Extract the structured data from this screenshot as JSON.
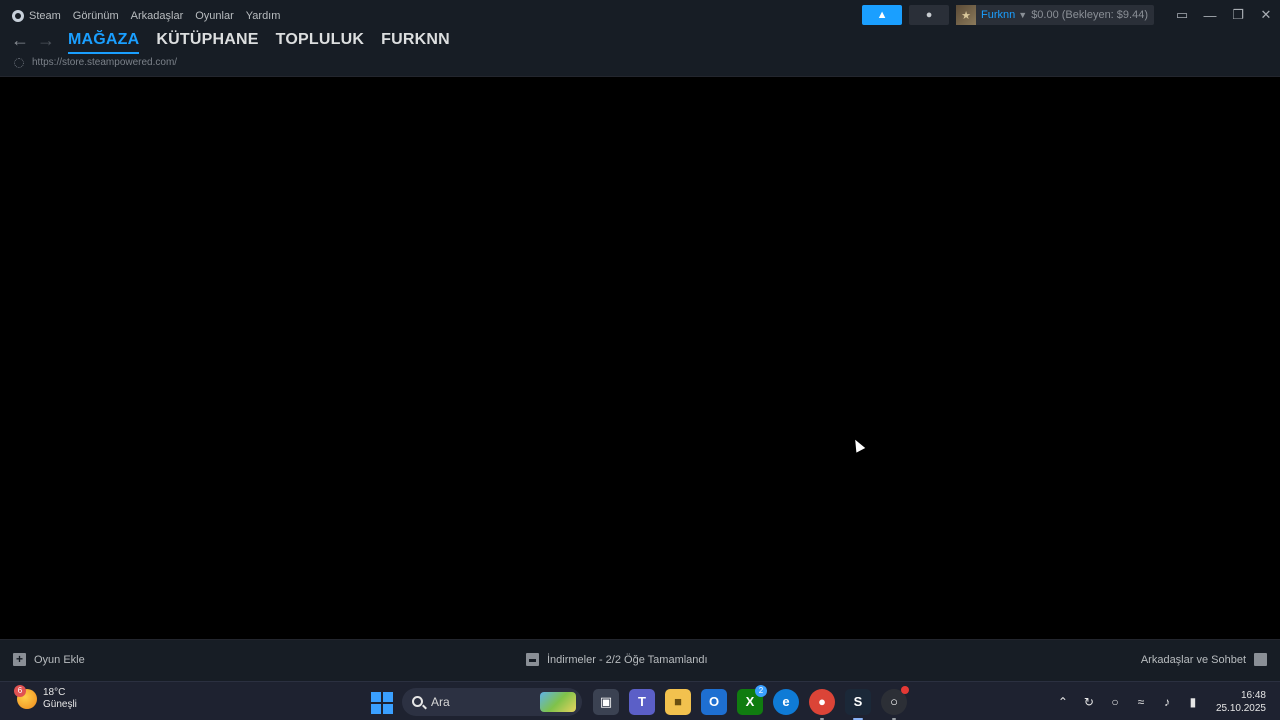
{
  "menubar": {
    "app_label": "Steam",
    "items": [
      "Görünüm",
      "Arkadaşlar",
      "Oyunlar",
      "Yardım"
    ]
  },
  "nav": {
    "back_icon": "arrow-left-icon",
    "forward_icon": "arrow-right-icon",
    "tabs": [
      {
        "label": "MAĞAZA",
        "active": true
      },
      {
        "label": "KÜTÜPHANE",
        "active": false
      },
      {
        "label": "TOPLULUK",
        "active": false
      },
      {
        "label": "FURKNN",
        "active": false
      }
    ],
    "url": "https://store.steampowered.com/"
  },
  "account": {
    "name": "Furknn",
    "balance": "$0.00 (Bekleyen: $9.44)"
  },
  "footer": {
    "add_game": "Oyun Ekle",
    "downloads": "İndirmeler - 2/2 Öğe Tamamlandı",
    "friends_chat": "Arkadaşlar ve Sohbet"
  },
  "taskbar": {
    "weather_temp": "18°C",
    "weather_desc": "Güneşli",
    "weather_badge": "6",
    "search_placeholder": "Ara",
    "xbox_badge": "2",
    "time": "16:48",
    "date": "25.10.2025"
  },
  "colors": {
    "accent": "#1a9fff",
    "chrome_bg": "#171d25",
    "content_bg": "#000000"
  }
}
